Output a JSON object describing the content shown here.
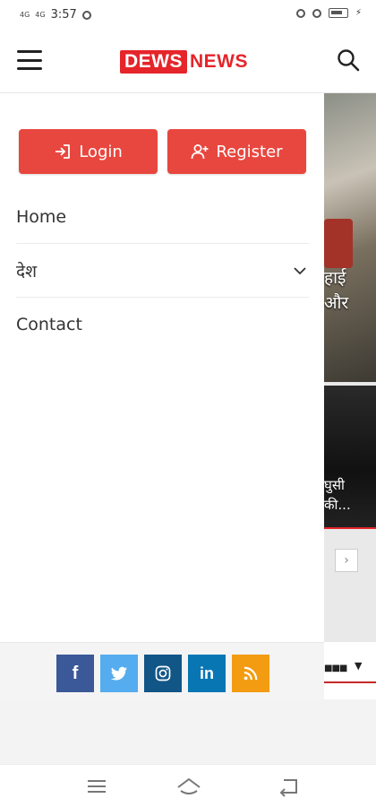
{
  "status_bar": {
    "network_1": "4G",
    "network_2": "4G",
    "time": "3:57"
  },
  "header": {
    "logo_boxed": "DEWS",
    "logo_plain": "NEWS"
  },
  "drawer": {
    "login_label": "Login",
    "register_label": "Register",
    "menu": [
      {
        "label": "Home"
      },
      {
        "label": "देश"
      },
      {
        "label": "Contact"
      }
    ],
    "social": [
      {
        "name": "facebook",
        "color": "#3b5998",
        "glyph": "f"
      },
      {
        "name": "twitter",
        "color": "#55acee",
        "glyph": ""
      },
      {
        "name": "instagram",
        "color": "#125688",
        "glyph": ""
      },
      {
        "name": "linkedin",
        "color": "#0976b4",
        "glyph": "in"
      },
      {
        "name": "rss",
        "color": "#f39c12",
        "glyph": ""
      }
    ]
  },
  "background": {
    "caption_1_line1": "हाई",
    "caption_1_line2": "और",
    "caption_2_line1": "घुसी",
    "caption_2_line2": "की..."
  },
  "colors": {
    "accent": "#e8473f",
    "brand_red": "#e5252a"
  }
}
